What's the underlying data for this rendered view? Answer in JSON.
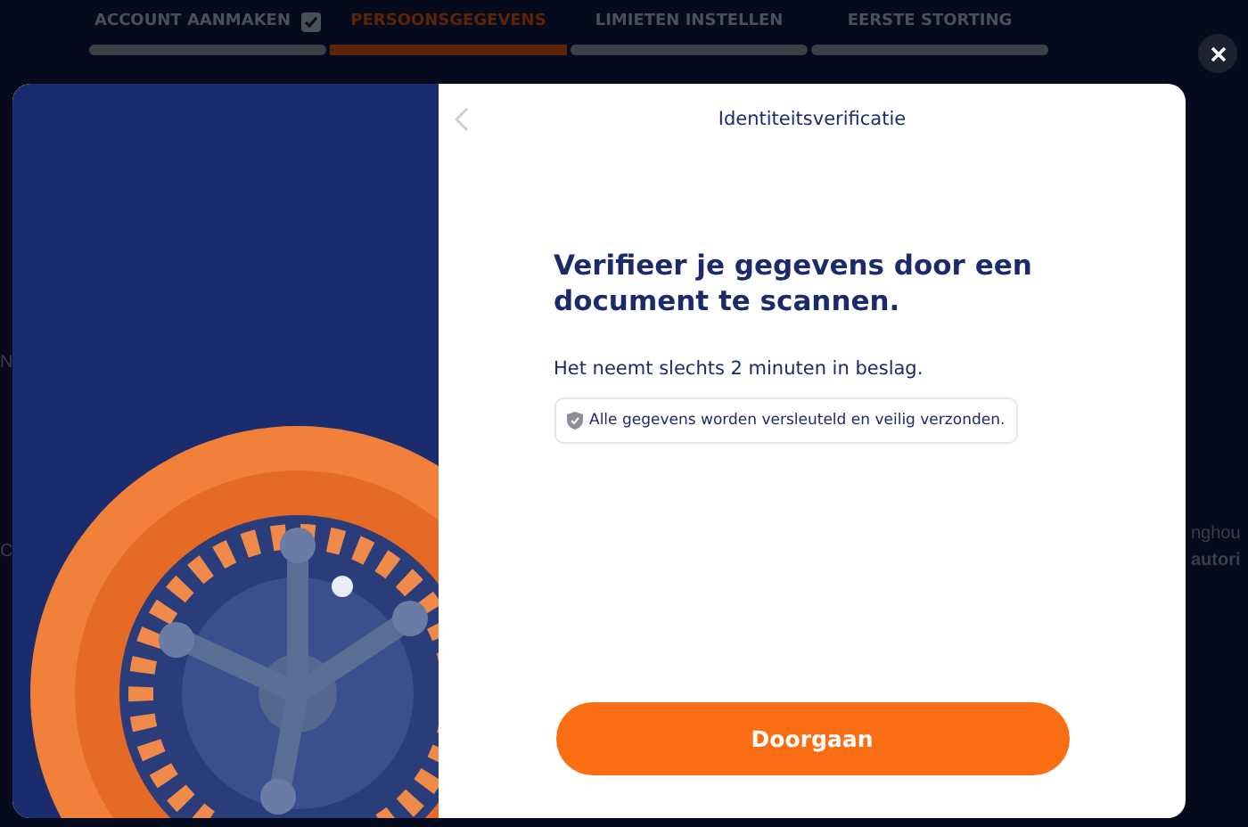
{
  "stepper": [
    {
      "label": "ACCOUNT AANMAKEN",
      "completed": true,
      "selected": false
    },
    {
      "label": "PERSOONSGEGEVENS",
      "completed": false,
      "selected": true
    },
    {
      "label": "LIMIETEN INSTELLEN",
      "completed": false,
      "selected": false
    },
    {
      "label": "EERSTE STORTING",
      "completed": false,
      "selected": false
    }
  ],
  "background_fragments": {
    "left": [
      "N",
      "C"
    ],
    "right": [
      "nghou",
      "autori"
    ]
  },
  "modal": {
    "title": "Identiteitsverificatie",
    "heading": "Verifieer je gegevens door een document te scannen.",
    "subtext": "Het neemt slechts 2 minuten in beslag.",
    "notice": "Alle gegevens worden versleuteld en veilig verzonden.",
    "button": "Doorgaan"
  }
}
